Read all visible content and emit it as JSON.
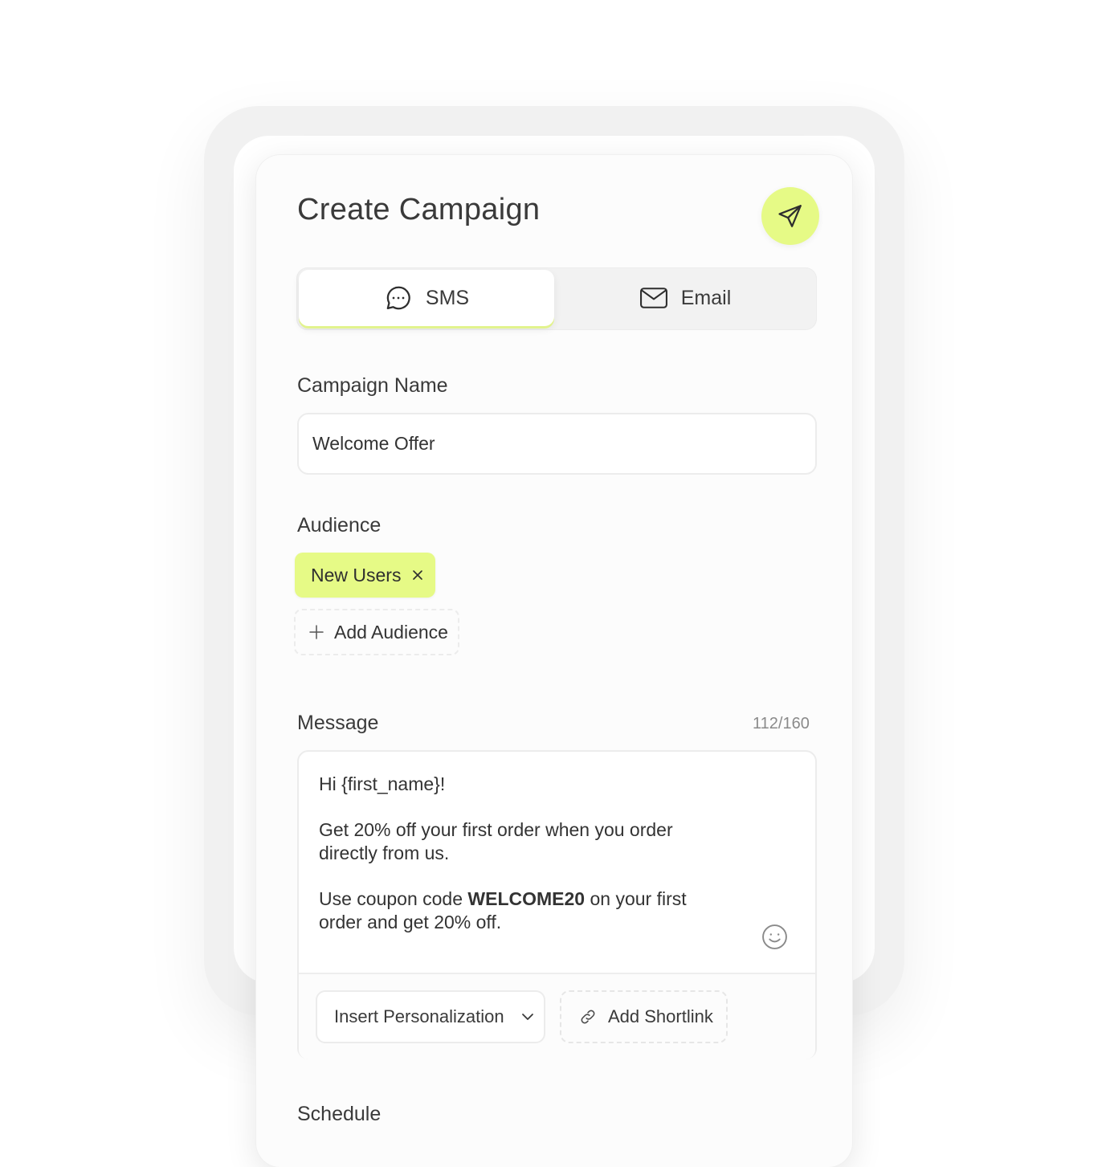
{
  "title": "Create Campaign",
  "tabs": {
    "sms": "SMS",
    "email": "Email",
    "active": "sms"
  },
  "campaign_name": {
    "label": "Campaign Name",
    "value": "Welcome Offer"
  },
  "audience": {
    "label": "Audience",
    "chips": [
      "New Users"
    ],
    "add_label": "Add Audience"
  },
  "message": {
    "label": "Message",
    "counter": "112/160",
    "line1": "Hi {first_name}!",
    "line2": "Get 20% off your first order when you order directly from us.",
    "line3_prefix": "Use coupon code ",
    "coupon": "WELCOME20",
    "line3_suffix": " on your first order and get 20% off.",
    "insert_personalization": "Insert Personalization",
    "add_shortlink": "Add Shortlink"
  },
  "schedule": {
    "label": "Schedule"
  },
  "colors": {
    "accent": "#e6fa86"
  }
}
